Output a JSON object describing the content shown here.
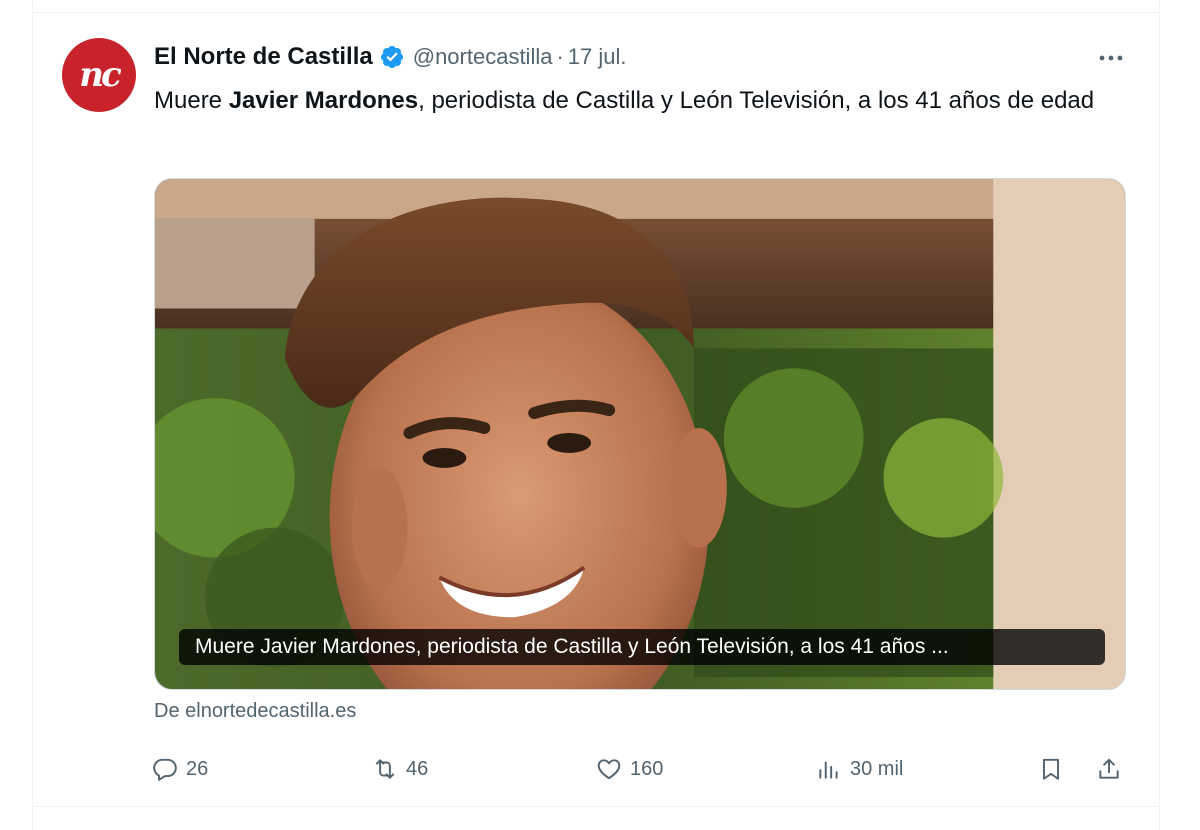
{
  "tweet": {
    "author_name": "El Norte de Castilla",
    "avatar_initials": "nc",
    "handle": "@nortecastilla",
    "separator": "·",
    "date": "17 jul.",
    "more_label": "···",
    "text_prefix": "Muere ",
    "text_bold": "Javier Mardones",
    "text_suffix": ", periodista de Castilla y León Televisión, a los 41 años de edad",
    "card_caption": "Muere Javier Mardones, periodista de Castilla y León Televisión, a los 41 años ...",
    "card_source": "De elnortedecastilla.es"
  },
  "actions": {
    "replies": "26",
    "retweets": "46",
    "likes": "160",
    "views": "30 mil"
  },
  "colors": {
    "brand_red": "#c8222a",
    "verified_blue": "#1d9bf0",
    "secondary_text": "#536471"
  },
  "icons": [
    "verified-badge-icon",
    "more-icon",
    "reply-icon",
    "retweet-icon",
    "like-icon",
    "views-icon",
    "bookmark-icon",
    "share-icon"
  ]
}
